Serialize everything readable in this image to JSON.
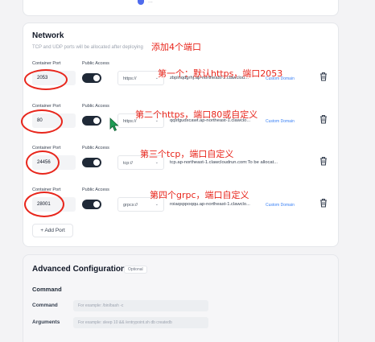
{
  "top_fragment": "...",
  "network": {
    "title": "Network",
    "subtitle": "TCP and UDP ports will be allocated after deploying",
    "label_port": "Container Port",
    "label_public": "Public Access",
    "custom_domain_label": "Custom Domain",
    "rows": [
      {
        "port": "2053",
        "protocol": "https://",
        "domain": "zbplnqdgrhj.ap-northeast-1.clawclou...",
        "has_custom_domain": true
      },
      {
        "port": "80",
        "protocol": "https://",
        "domain": "qqsfgudxcawt.ap-northeast-1.clawclo...",
        "has_custom_domain": true
      },
      {
        "port": "24456",
        "protocol": "tcp://",
        "domain": "tcp.ap-northeast-1.clawcloudrun.com:To be allocat...",
        "has_custom_domain": false
      },
      {
        "port": "28001",
        "protocol": "grpcs://",
        "domain": "roiaqsppoqqu.ap-northeast-1.clawclo...",
        "has_custom_domain": true
      }
    ],
    "add_port_label": "+ Add Port"
  },
  "advanced": {
    "title": "Advanced Configuration",
    "badge": "Optional",
    "command_section": "Command",
    "fields": [
      {
        "label": "Command",
        "placeholder": "For example: /bin/bash -c"
      },
      {
        "label": "Arguments",
        "placeholder": "For example: sleep 10 && /entrypoint.sh db createdb"
      }
    ]
  },
  "annotations": {
    "add_four_ports": "添加4个端口",
    "row1": "第一个：默认https，端口2053",
    "row2": "第二个https，端口80或自定义",
    "row3": "第三个tcp，端口自定义",
    "row4": "第四个grpc，端口自定义"
  },
  "colors": {
    "accent_red": "#e8261c",
    "link_blue": "#3b82f6",
    "toggle_dark": "#1f2937"
  }
}
